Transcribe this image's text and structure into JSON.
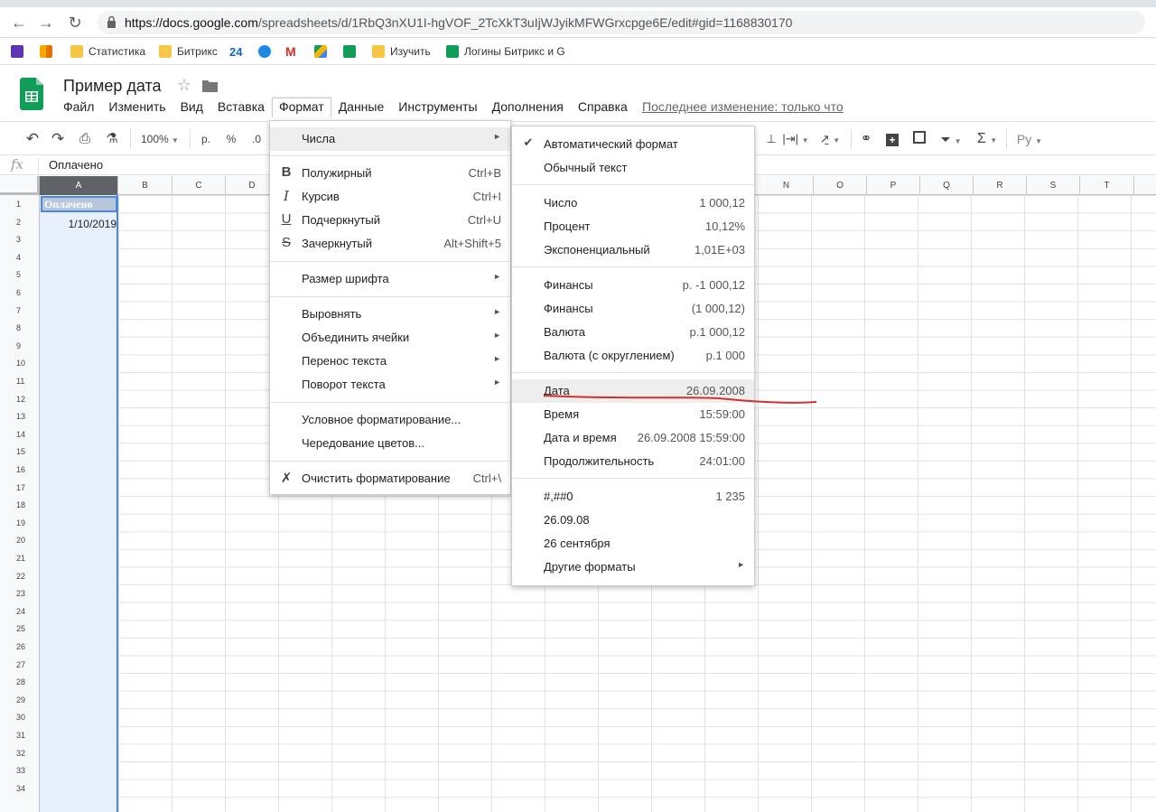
{
  "browser": {
    "url_host": "https://docs.google.com",
    "url_path": "/spreadsheets/d/1RbQ3nXU1I-hgVOF_2TcXkT3uIjWJyikMFWGrxcpge6E/edit#gid=1168830170",
    "bookmarks": [
      "Статистика",
      "Битрикс",
      "24",
      "Изучить",
      "Логины Битрикс и G"
    ]
  },
  "doc": {
    "title": "Пример дата",
    "last_edit": "Последнее изменение: только что"
  },
  "menubar": [
    "Файл",
    "Изменить",
    "Вид",
    "Вставка",
    "Формат",
    "Данные",
    "Инструменты",
    "Дополнения",
    "Справка"
  ],
  "toolbar": {
    "zoom": "100%",
    "currency": "р.",
    "percent": "%",
    "decimal": ".0",
    "sum": "Σ",
    "input_tools": "Ру"
  },
  "formula": {
    "fx": "fx",
    "value": "Оплачено"
  },
  "grid": {
    "columns": [
      "A",
      "B",
      "C",
      "D",
      "N",
      "O",
      "P",
      "Q",
      "R",
      "S",
      "T"
    ],
    "rows": [
      "1",
      "2",
      "3",
      "4",
      "5",
      "6",
      "7",
      "8",
      "9",
      "10",
      "11",
      "12",
      "13",
      "14",
      "15",
      "16",
      "17",
      "18",
      "19",
      "20",
      "21",
      "22",
      "23",
      "24",
      "25",
      "26",
      "27",
      "28",
      "29",
      "30",
      "31",
      "32",
      "33",
      "34"
    ],
    "cells": {
      "A1": "Оплачено",
      "A2": "1/10/2019"
    }
  },
  "format_menu": {
    "numbers": "Числа",
    "bold": "Полужирный",
    "bold_sc": "Ctrl+B",
    "italic": "Курсив",
    "italic_sc": "Ctrl+I",
    "underline": "Подчеркнутый",
    "underline_sc": "Ctrl+U",
    "strike": "Зачеркнутый",
    "strike_sc": "Alt+Shift+5",
    "font_size": "Размер шрифта",
    "align": "Выровнять",
    "merge": "Объединить ячейки",
    "wrap": "Перенос текста",
    "rotate": "Поворот текста",
    "conditional": "Условное форматирование...",
    "alternating": "Чередование цветов...",
    "clear": "Очистить форматирование",
    "clear_sc": "Ctrl+\\"
  },
  "numbers_menu": [
    {
      "label": "Автоматический формат",
      "example": "",
      "checked": true
    },
    {
      "label": "Обычный текст",
      "example": ""
    },
    {
      "label": "Число",
      "example": "1 000,12"
    },
    {
      "label": "Процент",
      "example": "10,12%"
    },
    {
      "label": "Экспоненциальный",
      "example": "1,01E+03"
    },
    {
      "label": "Финансы",
      "example": "р. -1 000,12"
    },
    {
      "label": "Финансы",
      "example": "(1 000,12)"
    },
    {
      "label": "Валюта",
      "example": "р.1 000,12"
    },
    {
      "label": "Валюта (с округлением)",
      "example": "р.1 000"
    },
    {
      "label": "Дата",
      "example": "26.09.2008"
    },
    {
      "label": "Время",
      "example": "15:59:00"
    },
    {
      "label": "Дата и время",
      "example": "26.09.2008 15:59:00"
    },
    {
      "label": "Продолжительность",
      "example": "24:01:00"
    },
    {
      "label": "#,##0",
      "example": "1 235"
    },
    {
      "label": "26.09.08",
      "example": ""
    },
    {
      "label": "26 сентября",
      "example": ""
    },
    {
      "label": "Другие форматы",
      "example": ""
    }
  ],
  "colors": {
    "selection": "#4a89dc",
    "annotation": "#d32f2f",
    "sheets_green": "#0f9d58"
  }
}
